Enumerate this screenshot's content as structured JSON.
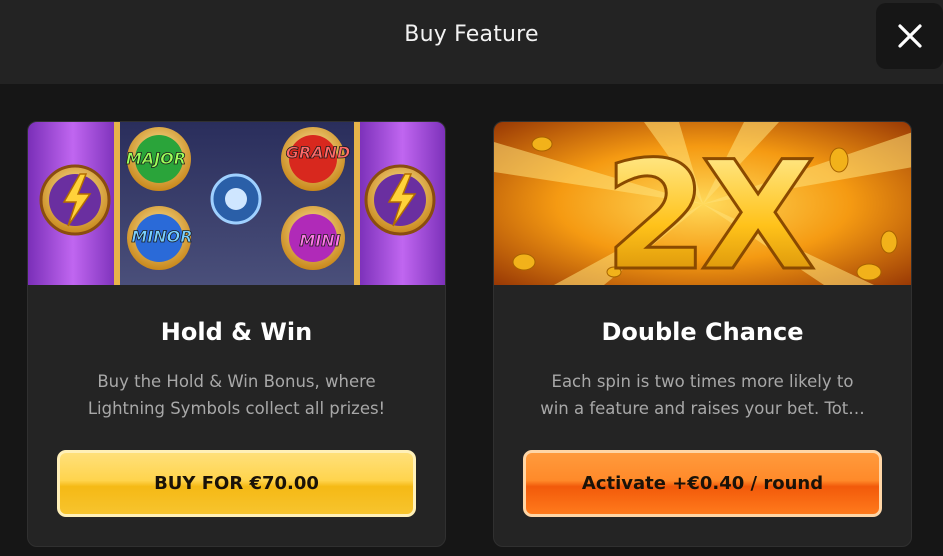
{
  "dialog": {
    "title": "Buy Feature",
    "close_icon": "close-icon"
  },
  "cards": [
    {
      "title": "Hold & Win",
      "description_lines": [
        "Buy the Hold & Win Bonus, where",
        "Lightning Symbols collect all prizes!"
      ],
      "button_label": "BUY FOR €70.00",
      "banner_labels": [
        "MAJOR",
        "GRAND",
        "MINOR",
        "MINI"
      ],
      "accent": "#ffd44d"
    },
    {
      "title": "Double Chance",
      "description_lines": [
        "Each spin is two times more likely to",
        "win a feature and raises your bet. Tot…"
      ],
      "button_label": "Activate +€0.40 / round",
      "banner_text": "2X",
      "accent": "#ff8a2a"
    }
  ],
  "colors": {
    "background": "#161616",
    "header": "#232323",
    "card": "#242424"
  }
}
